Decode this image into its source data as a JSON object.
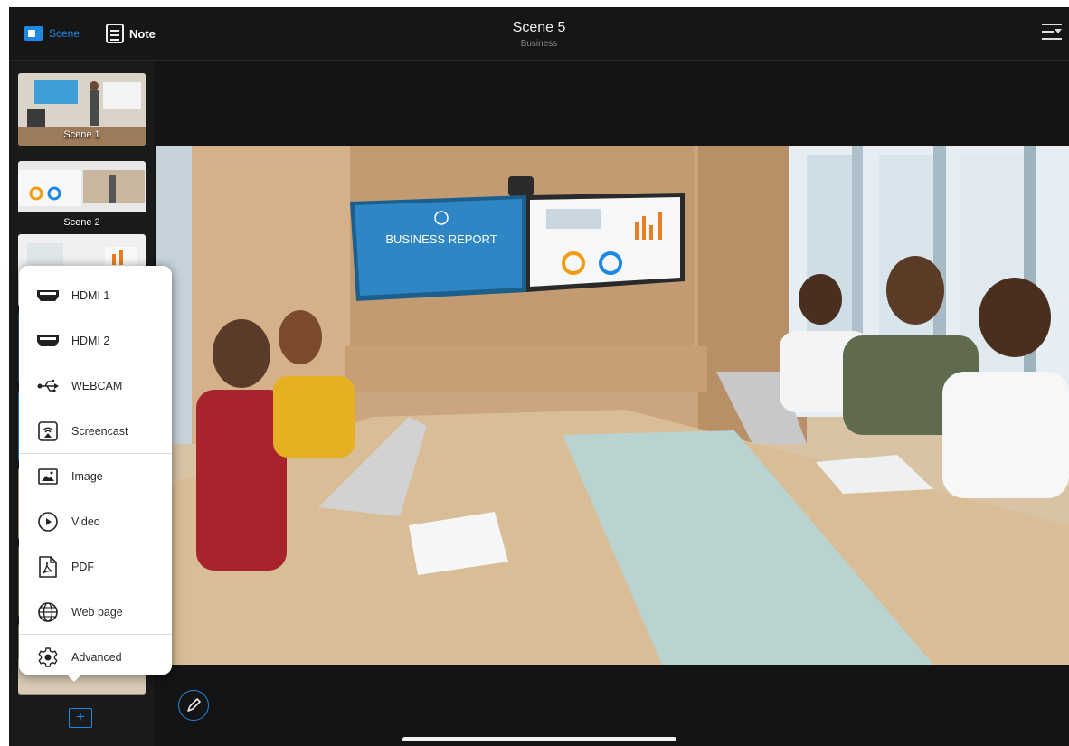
{
  "header": {
    "scene_tab_label": "Scene",
    "note_tab_label": "Note",
    "title": "Scene 5",
    "subtitle": "Business"
  },
  "sidebar": {
    "scenes": [
      {
        "label": "Scene 1"
      },
      {
        "label": "Scene 2"
      },
      {
        "label": ""
      },
      {
        "label": ""
      },
      {
        "label": ""
      },
      {
        "label": ""
      },
      {
        "label": ""
      },
      {
        "label": ""
      },
      {
        "label": ""
      }
    ],
    "add_button_label": "+"
  },
  "stage": {
    "wall_screen_text": "BUSINESS REPORT"
  },
  "source_menu": {
    "items": [
      {
        "label": "HDMI 1",
        "icon": "hdmi-icon"
      },
      {
        "label": "HDMI 2",
        "icon": "hdmi-icon"
      },
      {
        "label": "WEBCAM",
        "icon": "usb-icon"
      },
      {
        "label": "Screencast",
        "icon": "screencast-icon"
      },
      {
        "label": "Image",
        "icon": "image-icon"
      },
      {
        "label": "Video",
        "icon": "video-play-icon"
      },
      {
        "label": "PDF",
        "icon": "pdf-icon"
      },
      {
        "label": "Web page",
        "icon": "globe-icon"
      },
      {
        "label": "Advanced",
        "icon": "gear-icon"
      }
    ]
  },
  "colors": {
    "accent": "#1e88e5",
    "background": "#141414"
  }
}
